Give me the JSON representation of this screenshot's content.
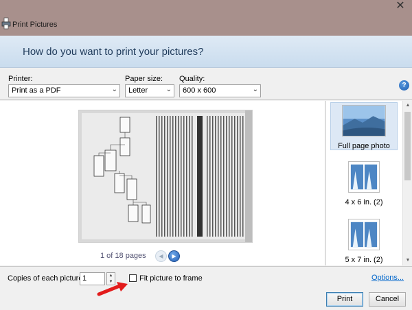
{
  "window": {
    "title": "Print Pictures",
    "close_glyph": "✕"
  },
  "header": {
    "heading": "How do you want to print your pictures?"
  },
  "controls": {
    "printer": {
      "label": "Printer:",
      "value": "Print as a PDF"
    },
    "paper_size": {
      "label": "Paper size:",
      "value": "Letter"
    },
    "quality": {
      "label": "Quality:",
      "value": "600 x 600"
    },
    "help_glyph": "?"
  },
  "preview": {
    "pager_text": "1 of 18 pages",
    "prev_glyph": "◀",
    "next_glyph": "▶"
  },
  "layouts": {
    "items": [
      {
        "label": "Full page photo",
        "selected": true
      },
      {
        "label": "4 x 6 in. (2)",
        "selected": false
      },
      {
        "label": "5 x 7 in. (2)",
        "selected": false
      }
    ],
    "scroll_up_glyph": "▲",
    "scroll_down_glyph": "▼"
  },
  "bottom": {
    "copies_label": "Copies of each picture:",
    "copies_value": "1",
    "fit_label": "Fit picture to frame",
    "fit_checked": false,
    "options_label": "Options...",
    "print_label": "Print",
    "cancel_label": "Cancel"
  },
  "colors": {
    "titlebar": "#a8908c",
    "header_text": "#1e3a5a",
    "link": "#0066cc",
    "annotation_arrow": "#e21b1b"
  },
  "icons": {
    "app": "printer-icon",
    "help": "help-icon",
    "annotation": "red-arrow-icon"
  }
}
